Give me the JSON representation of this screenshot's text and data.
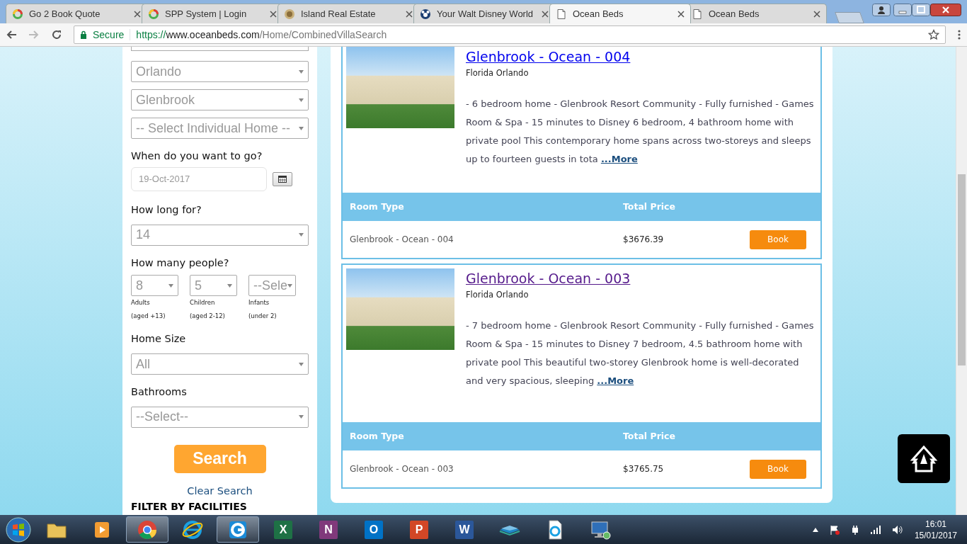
{
  "browser": {
    "tabs": [
      {
        "kind": "ring",
        "title": "Go 2 Book Quote",
        "selected": false
      },
      {
        "kind": "ring",
        "title": "SPP System | Login",
        "selected": false
      },
      {
        "kind": "photo",
        "title": "Island Real Estate",
        "selected": false
      },
      {
        "kind": "mouse",
        "title": "Your Walt Disney World",
        "selected": false
      },
      {
        "kind": "page",
        "title": "Ocean Beds",
        "selected": true
      },
      {
        "kind": "page",
        "title": "Ocean Beds",
        "selected": false
      }
    ],
    "secure_label": "Secure",
    "url_scheme": "https://",
    "url_host": "www.oceanbeds.com",
    "url_path": "/Home/CombinedVillaSearch"
  },
  "search_form": {
    "location_selects": [
      {
        "value": "Orlando"
      },
      {
        "value": "Glenbrook"
      },
      {
        "value": "-- Select Individual Home --"
      }
    ],
    "date_label": "When do you want to go?",
    "date_value": "19-Oct-2017",
    "duration_label": "How long for?",
    "duration_value": "14",
    "people_label": "How many people?",
    "people": [
      {
        "value": "8",
        "label": "Adults",
        "note": "(aged +13)"
      },
      {
        "value": "5",
        "label": "Children",
        "note": "(aged 2-12)"
      },
      {
        "value": "--Sele",
        "label": "Infants",
        "note": "(under 2)"
      }
    ],
    "home_size_label": "Home Size",
    "home_size_value": "All",
    "bathrooms_label": "Bathrooms",
    "bathrooms_value": "--Select--",
    "search_button": "Search",
    "clear_search": "Clear Search",
    "filter_heading": "FILTER BY FACILITIES"
  },
  "listings": [
    {
      "title": "Glenbrook - Ocean - 004",
      "visited": false,
      "location": "Florida Orlando",
      "description": "- 6 bedroom home - Glenbrook Resort Community - Fully furnished - Games Room & Spa - 15 minutes to Disney 6 bedroom, 4 bathroom home with private pool This contemporary home spans across two-storeys and sleeps up to fourteen guests in tota",
      "more": "...More",
      "room_type_header": "Room Type",
      "total_price_header": "Total Price",
      "room_type": "Glenbrook - Ocean - 004",
      "price": "$3676.39",
      "book": "Book"
    },
    {
      "title": "Glenbrook - Ocean - 003",
      "visited": true,
      "location": "Florida Orlando",
      "description": "- 7 bedroom home - Glenbrook Resort Community - Fully furnished - Games Room & Spa - 15 minutes to Disney 7 bedroom, 4.5 bathroom home with private pool This beautiful two-storey Glenbrook home is well-decorated and very spacious, sleeping",
      "more": "...More",
      "room_type_header": "Room Type",
      "total_price_header": "Total Price",
      "room_type": "Glenbrook - Ocean - 003",
      "price": "$3765.75",
      "book": "Book"
    }
  ],
  "taskbar": {
    "apps": [
      {
        "kind": "folder",
        "selected": false
      },
      {
        "kind": "media",
        "selected": false
      },
      {
        "kind": "chrome",
        "selected": true
      },
      {
        "kind": "ie",
        "selected": false
      },
      {
        "kind": "gapp",
        "selected": true
      },
      {
        "kind": "office",
        "glyph": "X",
        "color": "#1e7145",
        "selected": false
      },
      {
        "kind": "office",
        "glyph": "N",
        "color": "#80397b",
        "selected": false
      },
      {
        "kind": "office",
        "glyph": "O",
        "color": "#0072c6",
        "selected": false
      },
      {
        "kind": "office",
        "glyph": "P",
        "color": "#d24726",
        "selected": false
      },
      {
        "kind": "office",
        "glyph": "W",
        "color": "#2b579a",
        "selected": false
      },
      {
        "kind": "stack",
        "selected": false
      },
      {
        "kind": "iedoc",
        "selected": false
      },
      {
        "kind": "monitor",
        "selected": false
      }
    ],
    "time": "16:01",
    "date": "15/01/2017"
  }
}
